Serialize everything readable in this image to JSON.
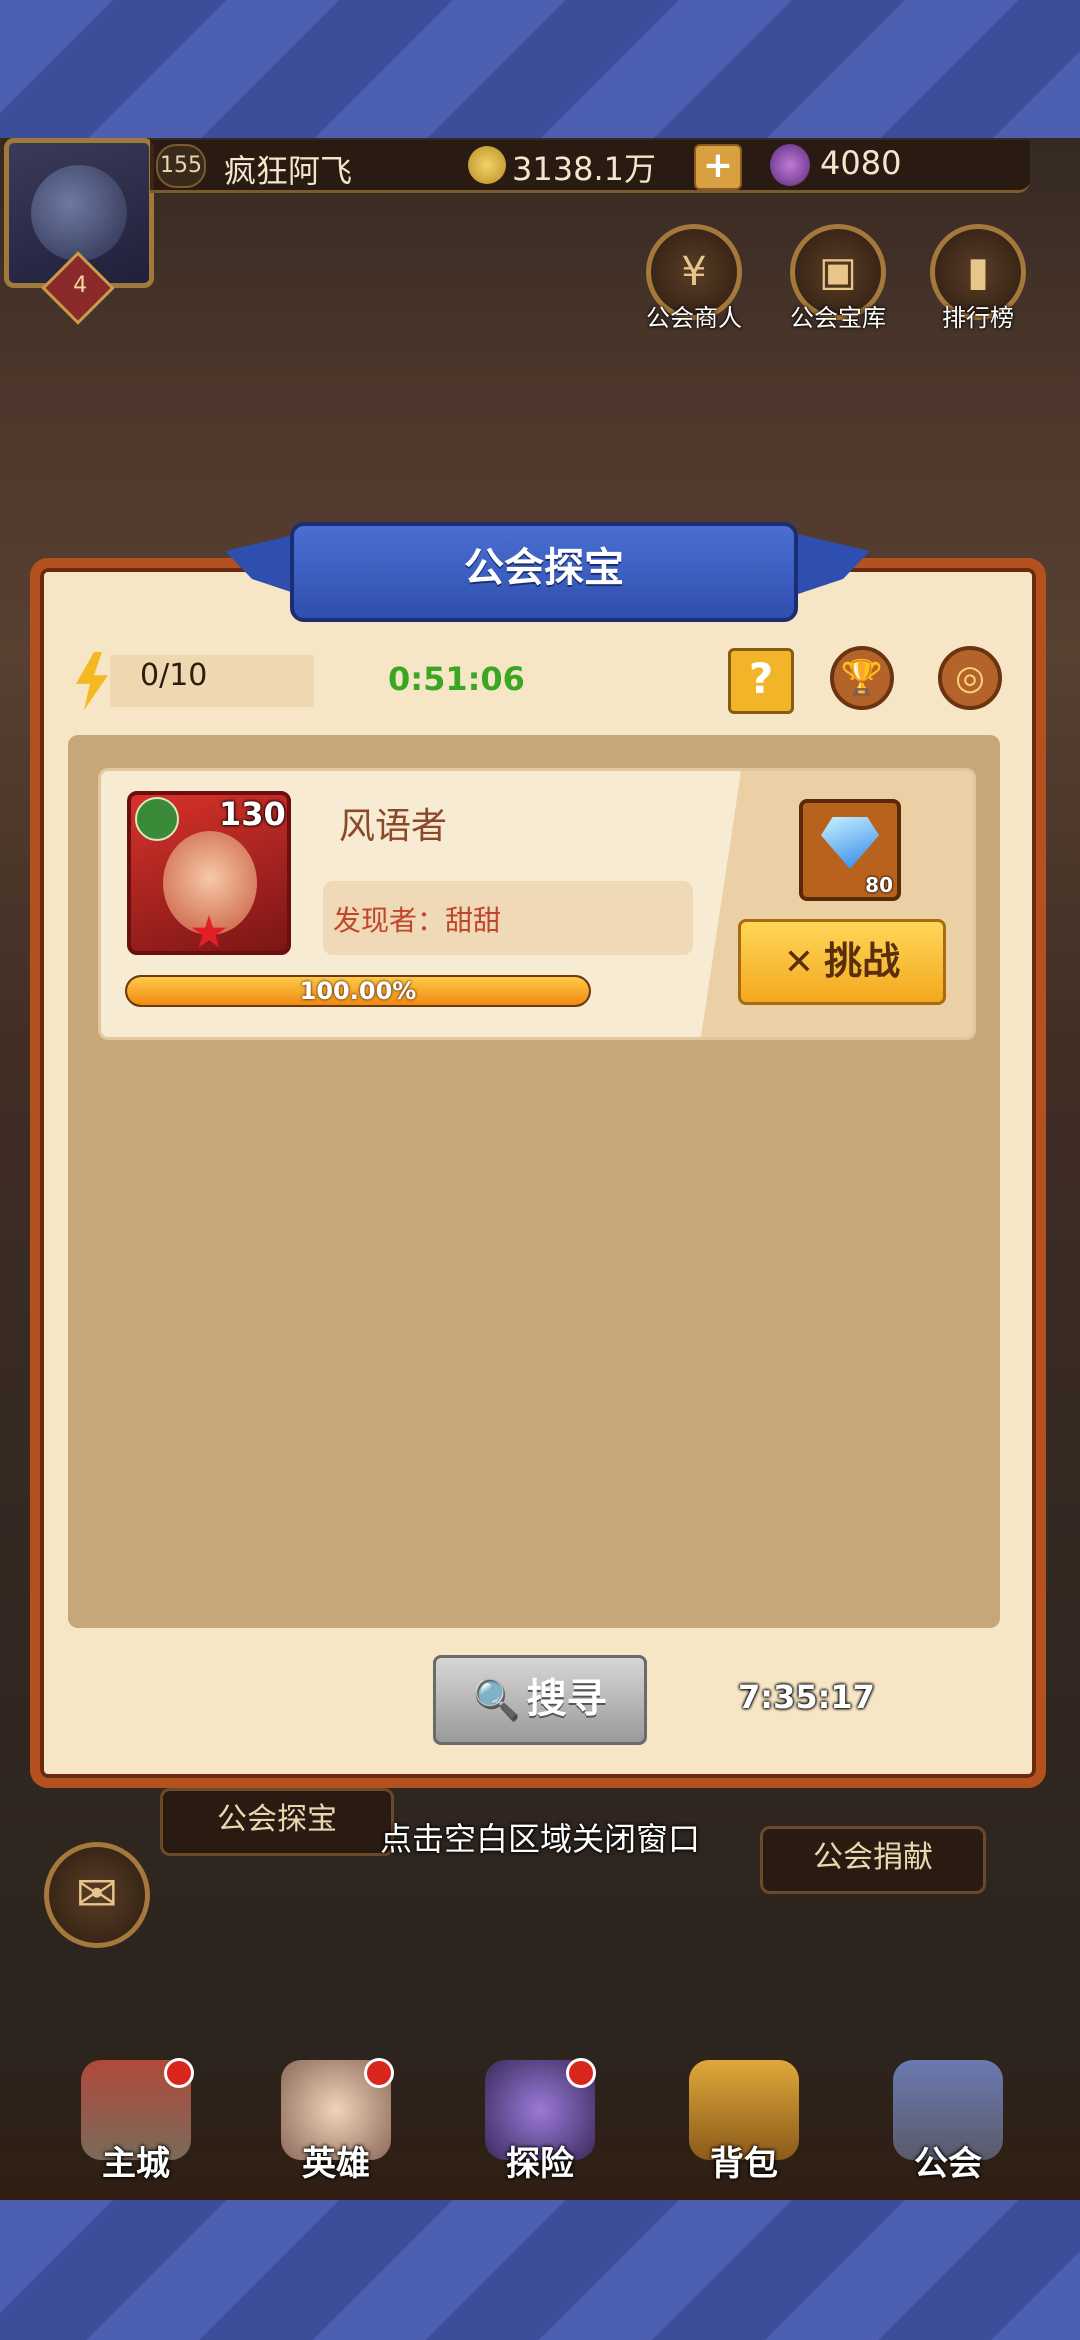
{
  "player": {
    "avatar_level": "4",
    "level": "155",
    "name": "疯狂阿飞",
    "coins": "3138.1万",
    "gems": "4080"
  },
  "top_buttons": [
    {
      "label": "公会商人",
      "icon": "shop-icon"
    },
    {
      "label": "公会宝库",
      "icon": "treasure-chest-icon"
    },
    {
      "label": "排行榜",
      "icon": "leaderboard-icon"
    }
  ],
  "modal": {
    "title": "公会探宝",
    "energy": "0/10",
    "countdown": "0:51:06",
    "help_label": "?",
    "card": {
      "hero_name": "风语者",
      "hero_level": "130",
      "finder": "发现者：甜甜",
      "progress_text": "100.00%",
      "progress_value": 1.0,
      "reward_count": "80",
      "reward_icon": "diamond-icon",
      "challenge_label": "挑战"
    },
    "search_label": "搜寻",
    "search_timer": "7:35:17"
  },
  "close_hint": "点击空白区域关闭窗口",
  "side_labels": {
    "left": "公会探宝",
    "right": "公会捐献"
  },
  "bottom_nav": [
    {
      "label": "主城",
      "badge": true
    },
    {
      "label": "英雄",
      "badge": true
    },
    {
      "label": "探险",
      "badge": true
    },
    {
      "label": "背包",
      "badge": false
    },
    {
      "label": "公会",
      "badge": false
    }
  ],
  "colors": {
    "modal_border": "#b5511e",
    "banner": "#2f4fb0",
    "timer_green": "#3ba624",
    "button_gold": "#f3a91e"
  }
}
